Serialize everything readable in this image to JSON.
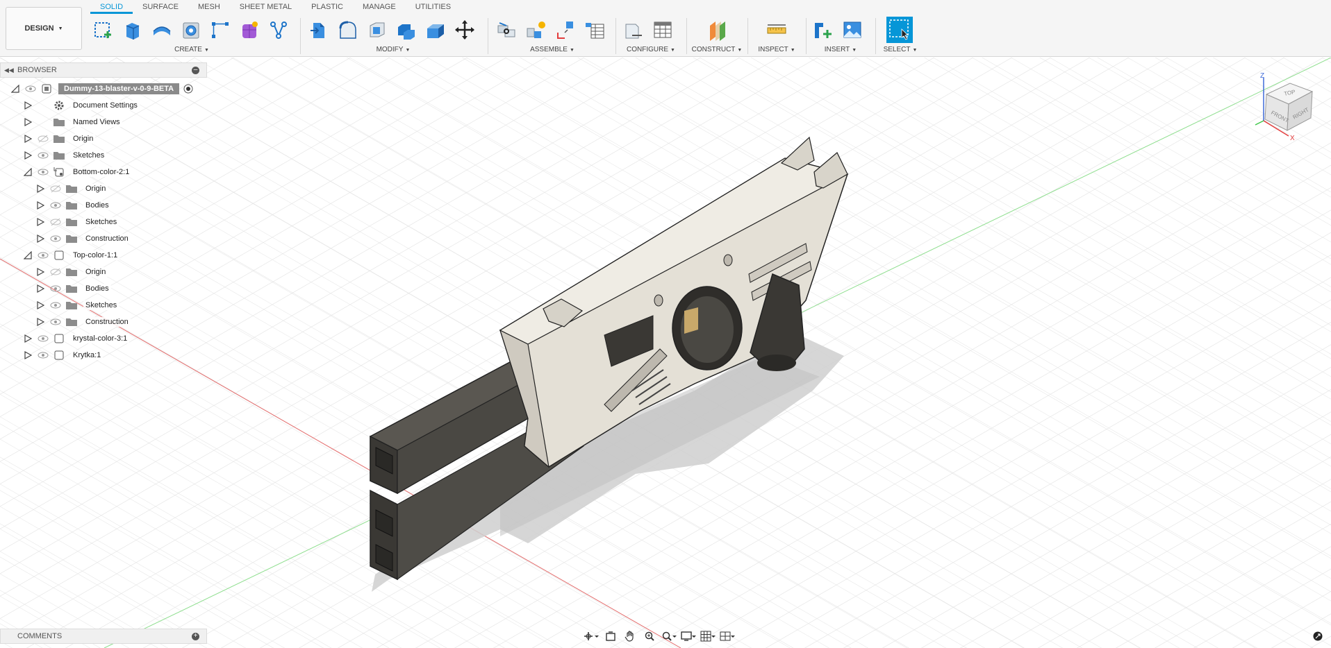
{
  "workspace": {
    "label": "DESIGN"
  },
  "tabs": [
    {
      "label": "SOLID",
      "active": true
    },
    {
      "label": "SURFACE"
    },
    {
      "label": "MESH"
    },
    {
      "label": "SHEET METAL"
    },
    {
      "label": "PLASTIC"
    },
    {
      "label": "MANAGE"
    },
    {
      "label": "UTILITIES"
    }
  ],
  "toolbar_groups": {
    "create": {
      "label": "CREATE",
      "icons": [
        "create-sketch-icon",
        "extrude-icon",
        "revolve-icon",
        "hole-icon",
        "pattern-icon",
        "form-icon",
        "derive-icon"
      ]
    },
    "modify": {
      "label": "MODIFY",
      "icons": [
        "press-pull-icon",
        "fillet-icon",
        "shell-icon",
        "combine-icon",
        "offset-face-icon",
        "move-icon"
      ]
    },
    "assemble": {
      "label": "ASSEMBLE",
      "icons": [
        "joint-icon",
        "new-component-icon",
        "as-built-joint-icon",
        "bom-icon"
      ]
    },
    "configure": {
      "label": "CONFIGURE",
      "icons": [
        "configure-icon",
        "table-icon"
      ]
    },
    "construct": {
      "label": "CONSTRUCT",
      "icons": [
        "offset-plane-icon"
      ]
    },
    "inspect": {
      "label": "INSPECT",
      "icons": [
        "measure-icon"
      ]
    },
    "insert": {
      "label": "INSERT",
      "icons": [
        "insert-derive-icon",
        "insert-image-icon"
      ]
    },
    "select": {
      "label": "SELECT",
      "icons": [
        "select-window-icon"
      ]
    }
  },
  "browser": {
    "title": "BROWSER",
    "items": [
      {
        "label": "Dummy-13-blaster-v-0-9-BETA",
        "type": "root",
        "expanded": true,
        "visible": true
      },
      {
        "label": "Document Settings",
        "icon": "gear-icon"
      },
      {
        "label": "Named Views",
        "icon": "folder-icon"
      },
      {
        "label": "Origin",
        "icon": "folder-icon",
        "visible": false
      },
      {
        "label": "Sketches",
        "icon": "folder-icon",
        "visible": true
      },
      {
        "label": "Bottom-color-2:1",
        "icon": "component-active-icon",
        "expanded": true,
        "visible": true
      },
      {
        "label": "Origin",
        "icon": "folder-icon",
        "visible": false
      },
      {
        "label": "Bodies",
        "icon": "folder-icon",
        "visible": true
      },
      {
        "label": "Sketches",
        "icon": "folder-icon",
        "visible": false
      },
      {
        "label": "Construction",
        "icon": "folder-icon",
        "visible": true
      },
      {
        "label": "Top-color-1:1",
        "icon": "component-icon",
        "expanded": true,
        "visible": true
      },
      {
        "label": "Origin",
        "icon": "folder-icon",
        "visible": false
      },
      {
        "label": "Bodies",
        "icon": "folder-icon",
        "visible": true
      },
      {
        "label": "Sketches",
        "icon": "folder-icon",
        "visible": true
      },
      {
        "label": "Construction",
        "icon": "folder-icon",
        "visible": true
      },
      {
        "label": "krystal-color-3:1",
        "icon": "component-icon",
        "visible": true
      },
      {
        "label": "Krytka:1",
        "icon": "component-icon",
        "visible": true
      }
    ]
  },
  "viewcube": {
    "top": "TOP",
    "front": "FRONT",
    "right": "RIGHT",
    "z": "Z",
    "x": "X"
  },
  "comments": {
    "title": "COMMENTS"
  },
  "navbar": {
    "icons": [
      "orbit-icon",
      "look-at-icon",
      "pan-icon",
      "zoom-icon",
      "fit-icon",
      "display-settings-icon",
      "grid-icon",
      "viewports-icon"
    ]
  },
  "colors": {
    "accent": "#0696d7",
    "body_light": "#e4e0d6",
    "body_dark": "#3f3d39",
    "axis_x": "#e33c3c",
    "axis_y": "#3fc84a"
  }
}
